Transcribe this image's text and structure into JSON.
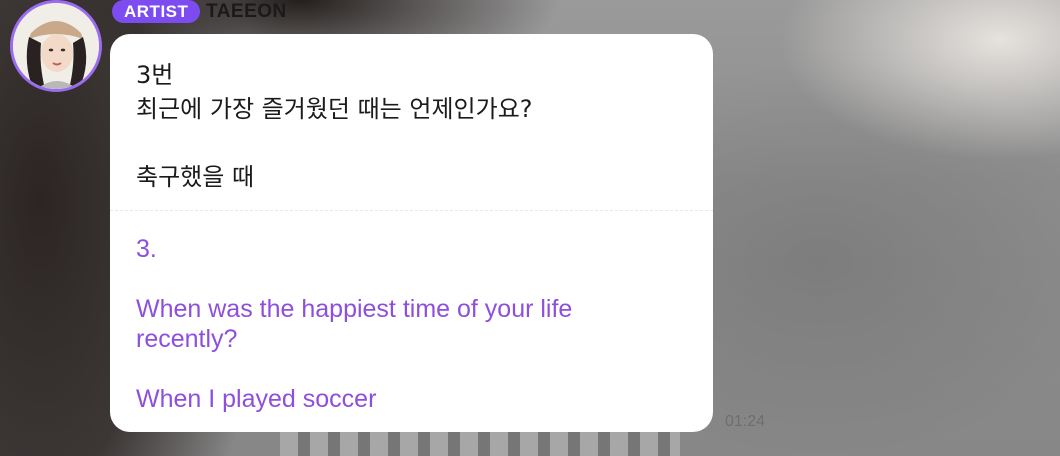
{
  "sender": {
    "badge": "ARTIST",
    "name": "TAEEON",
    "avatar_icon": "profile-photo"
  },
  "message": {
    "original_lines": [
      "3번",
      "최근에 가장 즐거웠던 때는 언제인가요?",
      "축구했을 때"
    ],
    "translation": {
      "number": "3.",
      "question_line1": "When was the happiest time of your life",
      "question_line2": "recently?",
      "answer": "When I played soccer"
    },
    "time": "01:24"
  },
  "colors": {
    "accent": "#7d4cf0",
    "translation_text": "#8d4fdc",
    "bubble": "#ffffff"
  }
}
